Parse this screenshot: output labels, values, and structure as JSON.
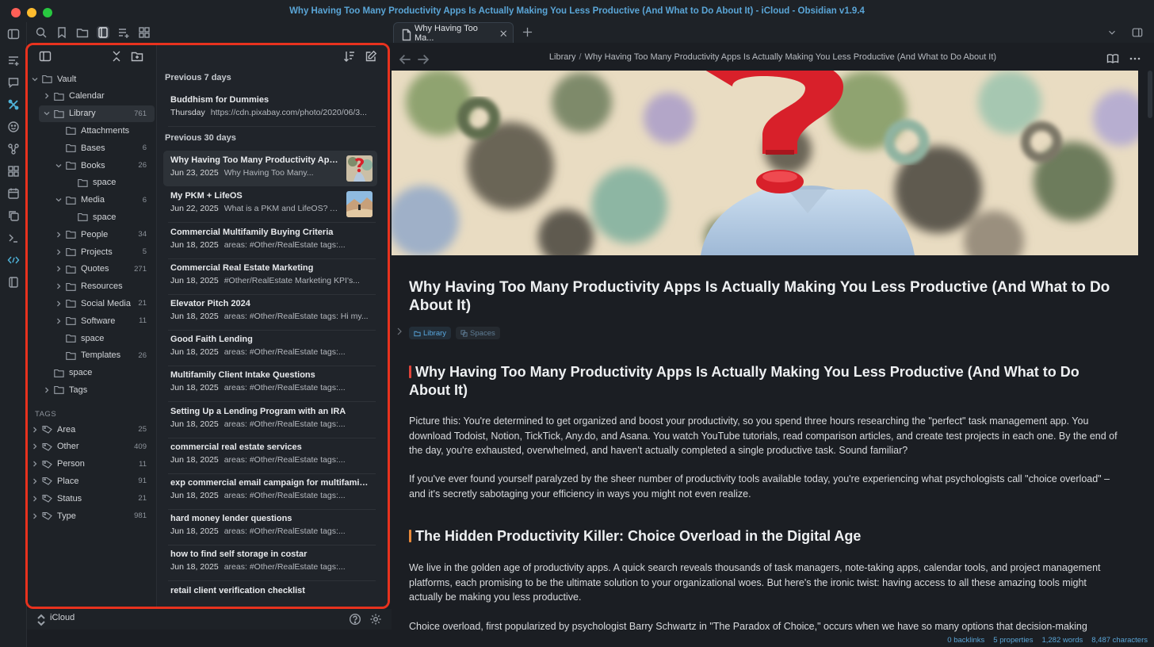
{
  "window": {
    "title": "Why Having Too Many Productivity Apps Is Actually Making You Less Productive (And What to Do About It) - iCloud - Obsidian v1.9.4"
  },
  "tree": {
    "items": [
      {
        "label": "Vault",
        "count": "",
        "depth": 0,
        "expanded": true
      },
      {
        "label": "Calendar",
        "count": "",
        "depth": 1,
        "expanded": false
      },
      {
        "label": "Library",
        "count": "761",
        "depth": 1,
        "expanded": true,
        "selected": true
      },
      {
        "label": "Attachments",
        "count": "",
        "depth": 2,
        "leaf": true
      },
      {
        "label": "Bases",
        "count": "6",
        "depth": 2,
        "leaf": true
      },
      {
        "label": "Books",
        "count": "26",
        "depth": 2,
        "expanded": true
      },
      {
        "label": "space",
        "count": "",
        "depth": 3,
        "leaf": true
      },
      {
        "label": "Media",
        "count": "6",
        "depth": 2,
        "expanded": true
      },
      {
        "label": "space",
        "count": "",
        "depth": 3,
        "leaf": true
      },
      {
        "label": "People",
        "count": "34",
        "depth": 2,
        "expanded": false
      },
      {
        "label": "Projects",
        "count": "5",
        "depth": 2,
        "expanded": false
      },
      {
        "label": "Quotes",
        "count": "271",
        "depth": 2,
        "expanded": false
      },
      {
        "label": "Resources",
        "count": "",
        "depth": 2,
        "expanded": false
      },
      {
        "label": "Social Media",
        "count": "21",
        "depth": 2,
        "expanded": false
      },
      {
        "label": "Software",
        "count": "11",
        "depth": 2,
        "expanded": false
      },
      {
        "label": "space",
        "count": "",
        "depth": 2,
        "leaf": true
      },
      {
        "label": "Templates",
        "count": "26",
        "depth": 2,
        "leaf": true
      },
      {
        "label": "space",
        "count": "",
        "depth": 1,
        "leaf": true
      },
      {
        "label": "Tags",
        "count": "",
        "depth": 1,
        "expanded": false
      }
    ]
  },
  "tags": {
    "heading": "TAGS",
    "items": [
      {
        "label": "Area",
        "count": "25"
      },
      {
        "label": "Other",
        "count": "409"
      },
      {
        "label": "Person",
        "count": "11"
      },
      {
        "label": "Place",
        "count": "91"
      },
      {
        "label": "Status",
        "count": "21"
      },
      {
        "label": "Type",
        "count": "981"
      }
    ]
  },
  "notes": {
    "groups": [
      {
        "label": "Previous 7 days",
        "items": [
          {
            "title": "Buddhism for Dummies",
            "date": "Thursday",
            "preview": "https://cdn.pixabay.com/photo/2020/06/3...",
            "thumb": ""
          }
        ]
      },
      {
        "label": "Previous 30 days",
        "items": [
          {
            "title": "Why Having Too Many Productivity App...",
            "date": "Jun 23, 2025",
            "preview": "Why Having Too Many...",
            "thumb": "question",
            "selected": true
          },
          {
            "title": "My PKM + LifeOS",
            "date": "Jun 22, 2025",
            "preview": "What is a PKM and LifeOS? A...",
            "thumb": "landscape"
          },
          {
            "title": "Commercial Multifamily Buying Criteria",
            "date": "Jun 18, 2025",
            "preview": "areas: #Other/RealEstate tags:...",
            "thumb": ""
          },
          {
            "title": "Commercial Real Estate Marketing",
            "date": "Jun 18, 2025",
            "preview": "#Other/RealEstate Marketing KPI's...",
            "thumb": ""
          },
          {
            "title": "Elevator Pitch 2024",
            "date": "Jun 18, 2025",
            "preview": "areas: #Other/RealEstate tags: Hi my...",
            "thumb": ""
          },
          {
            "title": "Good Faith Lending",
            "date": "Jun 18, 2025",
            "preview": "areas: #Other/RealEstate tags:...",
            "thumb": ""
          },
          {
            "title": "Multifamily Client Intake Questions",
            "date": "Jun 18, 2025",
            "preview": "areas: #Other/RealEstate tags:...",
            "thumb": ""
          },
          {
            "title": "Setting Up a Lending Program with an IRA",
            "date": "Jun 18, 2025",
            "preview": "areas: #Other/RealEstate tags:...",
            "thumb": ""
          },
          {
            "title": "commercial real estate services",
            "date": "Jun 18, 2025",
            "preview": "areas: #Other/RealEstate tags:...",
            "thumb": ""
          },
          {
            "title": "exp commercial email campaign for multifamily...",
            "date": "Jun 18, 2025",
            "preview": "areas: #Other/RealEstate tags:...",
            "thumb": ""
          },
          {
            "title": "hard money lender questions",
            "date": "Jun 18, 2025",
            "preview": "areas: #Other/RealEstate tags:...",
            "thumb": ""
          },
          {
            "title": "how to find self storage in costar",
            "date": "Jun 18, 2025",
            "preview": "areas: #Other/RealEstate tags:...",
            "thumb": ""
          },
          {
            "title": "retail client verification checklist",
            "date": "",
            "preview": "",
            "thumb": ""
          }
        ]
      }
    ]
  },
  "vault_footer": {
    "name": "iCloud"
  },
  "editor": {
    "tab_title": "Why Having Too Ma...",
    "breadcrumb": {
      "folder": "Library",
      "separator": "/",
      "file": "Why Having Too Many Productivity Apps Is Actually Making You Less Productive (And What to Do About It)"
    },
    "title": "Why Having Too Many Productivity Apps Is Actually Making You Less Productive (And What to Do About It)",
    "properties": [
      {
        "label": "Library",
        "style": "bright"
      },
      {
        "label": "Spaces",
        "style": "dim"
      }
    ],
    "h1_main": "Why Having Too Many Productivity Apps Is Actually Making You Less Productive (And What to Do About It)",
    "para1": "Picture this: You're determined to get organized and boost your productivity, so you spend three hours researching the \"perfect\" task management app. You download Todoist, Notion, TickTick, Any.do, and Asana. You watch YouTube tutorials, read comparison articles, and create test projects in each one. By the end of the day, you're exhausted, overwhelmed, and haven't actually completed a single productive task. Sound familiar?",
    "para2": "If you've ever found yourself paralyzed by the sheer number of productivity tools available today, you're experiencing what psychologists call \"choice overload\" – and it's secretly sabotaging your efficiency in ways you might not even realize.",
    "h1_second": "The Hidden Productivity Killer: Choice Overload in the Digital Age",
    "para3": "We live in the golden age of productivity apps. A quick search reveals thousands of task managers, note-taking apps, calendar tools, and project management platforms, each promising to be the ultimate solution to your organizational woes. But here's the ironic twist: having access to all these amazing tools might actually be making you less productive.",
    "para4": "Choice overload, first popularized by psychologist Barry Schwartz in \"The Paradox of Choice,\" occurs when we have so many options that decision-making"
  },
  "status": {
    "backlinks": "0 backlinks",
    "properties": "5 properties",
    "words": "1,282 words",
    "characters": "8,487 characters"
  },
  "colors": {
    "accent": "#5aa5d6",
    "highlight_border": "#e8321e",
    "h1_bar_red": "#e0443a",
    "h1_bar_orange": "#e8893a"
  }
}
